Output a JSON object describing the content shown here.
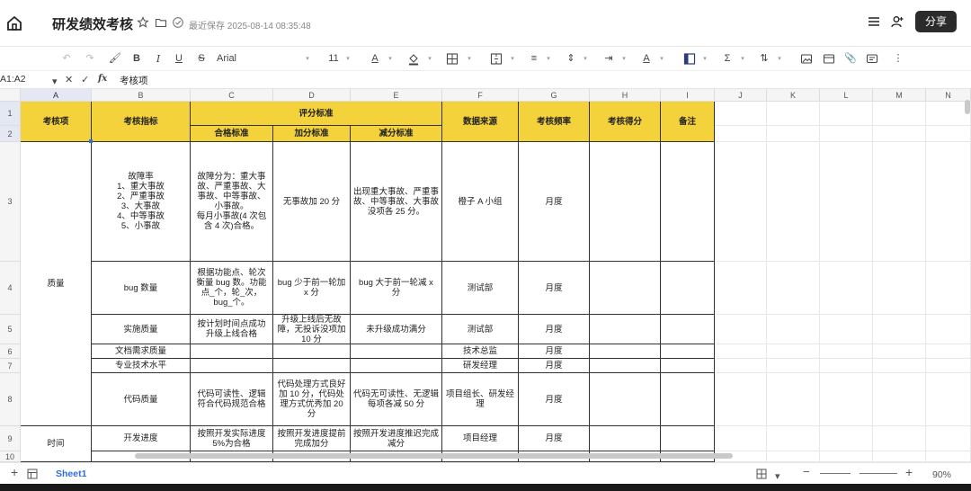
{
  "header": {
    "title": "研发绩效考核",
    "saved_text": "最近保存 2025-08-14 08:35:48",
    "share_label": "分享"
  },
  "toolbar": {
    "font_name": "Arial",
    "font_size": "11",
    "accent": "#f3d23c"
  },
  "formula_bar": {
    "cell_ref": "A1:A2",
    "fx_label": "fx",
    "value": "考核项"
  },
  "columns": [
    "A",
    "B",
    "C",
    "D",
    "E",
    "F",
    "G",
    "H",
    "I",
    "J",
    "K",
    "L",
    "M",
    "N"
  ],
  "rows": [
    "1",
    "2",
    "3",
    "4",
    "5",
    "6",
    "7",
    "8",
    "9",
    "10"
  ],
  "table": {
    "h_item": "考核项",
    "h_indicator": "考核指标",
    "h_scoring": "评分标准",
    "h_pass": "合格标准",
    "h_bonus": "加分标准",
    "h_deduct": "减分标准",
    "h_source": "数据来源",
    "h_freq": "考核频率",
    "h_score": "考核得分",
    "h_note": "备注",
    "quality": "质量",
    "time": "时间",
    "r3_b": "故障率\n1、重大事故\n2、严重事故\n3、大事故\n4、中等事故\n5、小事故",
    "r3_c": "故障分为：重大事故、严重事故、大事故、中等事故、小事故。\n每月小事故(4 次包含 4 次)合格。",
    "r3_d": "无事故加 20 分",
    "r3_e": "出现重大事故、严重事故、中等事故、大事故没项各 25 分。",
    "r3_f": "橙子 A 小组",
    "r3_g": "月度",
    "r4_b": "bug 数量",
    "r4_c": "根据功能点、轮次衡量 bug 数。功能点_个，轮_次，bug_个。",
    "r4_d": "bug 少于前一轮加 x 分",
    "r4_e": "bug 大于前一轮减 x 分",
    "r4_f": "测试部",
    "r4_g": "月度",
    "r5_b": "实施质量",
    "r5_c": "按计划时间点成功升级上线合格",
    "r5_d": "升级上线后无故障，无投诉没项加 10 分",
    "r5_e": "未升级成功满分",
    "r5_f": "测试部",
    "r5_g": "月度",
    "r6_b": "文档需求质量",
    "r6_f": "技术总监",
    "r6_g": "月度",
    "r7_b": "专业技术水平",
    "r7_f": "研发经理",
    "r7_g": "月度",
    "r8_b": "代码质量",
    "r8_c": "代码可读性、逻辑符合代码规范合格",
    "r8_d": "代码处理方式良好加 10 分，代码处理方式优秀加 20 分",
    "r8_e": "代码无可读性、无逻辑每项各减 50 分",
    "r8_f": "项目组长、研发经理",
    "r8_g": "月度",
    "r9_b": "开发进度",
    "r9_c": "按照开发实际进度 5%为合格",
    "r9_d": "按照开发进度提前完成加分",
    "r9_e": "按照开发进度推迟完成减分",
    "r9_f": "项目经理",
    "r9_g": "月度"
  },
  "footer": {
    "sheet_name": "Sheet1",
    "zoom": "90%"
  }
}
